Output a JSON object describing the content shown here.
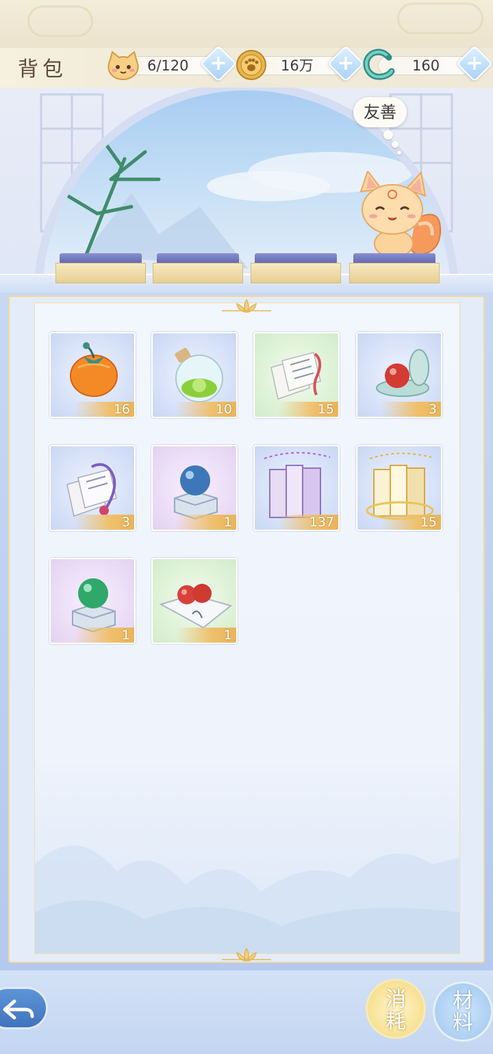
{
  "header": {
    "title": "背包",
    "currencies": [
      {
        "icon": "cat-face-icon",
        "value": "6/120"
      },
      {
        "icon": "paw-coin-icon",
        "value": "16万"
      },
      {
        "icon": "jade-dragon-icon",
        "value": "160"
      }
    ],
    "add_label": "+"
  },
  "scene": {
    "mood_label": "友善",
    "character": "fox-spirit-pet"
  },
  "inventory": {
    "items": [
      {
        "icon": "persimmon-fruit-icon",
        "count": "16",
        "bg": "#cfdcf6"
      },
      {
        "icon": "potion-flask-icon",
        "count": "10",
        "bg": "#cfdcf6"
      },
      {
        "icon": "scroll-pages-icon",
        "count": "15",
        "bg": "#dff1d8"
      },
      {
        "icon": "red-orb-compact-icon",
        "count": "3",
        "bg": "#cfdcf6"
      },
      {
        "icon": "purple-scroll-pages-icon",
        "count": "3",
        "bg": "#cfdcf6"
      },
      {
        "icon": "blue-orb-pedestal-icon",
        "count": "1",
        "bg": "#ecdcf3"
      },
      {
        "icon": "music-score-books-icon",
        "count": "137",
        "bg": "#cfdcf6"
      },
      {
        "icon": "golden-score-books-icon",
        "count": "15",
        "bg": "#cfdcf6"
      },
      {
        "icon": "green-orb-pedestal-icon",
        "count": "1",
        "bg": "#ecdcf3"
      },
      {
        "icon": "red-orbs-cloth-icon",
        "count": "1",
        "bg": "#dff1d8"
      }
    ]
  },
  "bottom": {
    "back_icon": "back-arrow-icon",
    "tab_consume": "消\n耗",
    "tab_material": "材\n料"
  }
}
